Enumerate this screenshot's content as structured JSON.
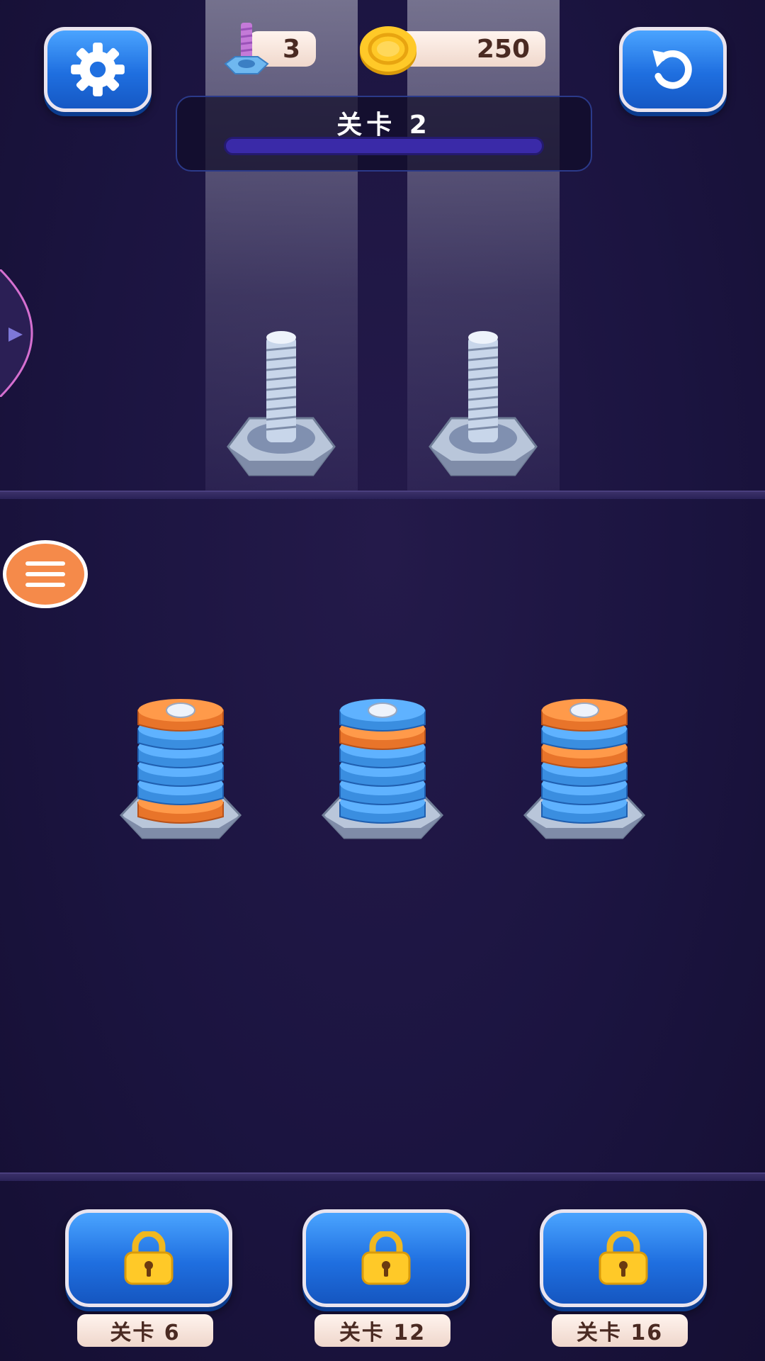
{
  "hud": {
    "screw_count": "3",
    "coins": "250",
    "level_title": "关卡 2",
    "level_progress": 0
  },
  "colors": {
    "background": "#1b1440",
    "accent_blue": "#1f6fe0",
    "nut_blue": "#3a8ee0",
    "nut_orange": "#e8742a",
    "menu_orange": "#f58a4a"
  },
  "empty_bolts": [
    {
      "id": "bolt-1"
    },
    {
      "id": "bolt-2"
    }
  ],
  "stacks": [
    {
      "id": "stack-1",
      "nuts_top_to_bottom": [
        "orange",
        "blue",
        "blue",
        "blue",
        "blue",
        "orange"
      ]
    },
    {
      "id": "stack-2",
      "nuts_top_to_bottom": [
        "blue",
        "orange",
        "blue",
        "blue",
        "blue",
        "blue"
      ]
    },
    {
      "id": "stack-3",
      "nuts_top_to_bottom": [
        "orange",
        "blue",
        "orange",
        "blue",
        "blue",
        "blue"
      ]
    }
  ],
  "locked_levels": [
    {
      "label": "关卡 6"
    },
    {
      "label": "关卡 12"
    },
    {
      "label": "关卡 16"
    }
  ],
  "icons": {
    "settings": "gear-icon",
    "undo": "undo-icon",
    "menu": "menu-icon",
    "lock": "lock-icon",
    "screw": "screw-icon",
    "coin": "coin-icon"
  }
}
